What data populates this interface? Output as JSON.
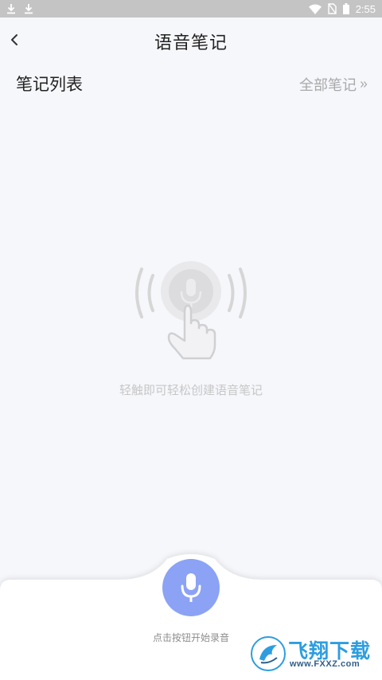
{
  "status_bar": {
    "time": "2:55",
    "icons": [
      "download-icon",
      "download-icon",
      "wifi-icon",
      "no-sim-icon",
      "battery-icon"
    ]
  },
  "header": {
    "title": "语音笔记",
    "back_icon": "chevron-left-icon"
  },
  "notes_list": {
    "title": "笔记列表",
    "all_notes_label": "全部笔记",
    "all_notes_icon": "chevron-double-right-icon"
  },
  "empty_state": {
    "illustration_icon": "touch-microphone-icon",
    "hint": "轻触即可轻松创建语音笔记"
  },
  "recorder": {
    "button_icon": "microphone-icon",
    "hint": "点击按钮开始录音"
  },
  "watermark": {
    "name": "飞翔下载",
    "url": "www.FXXZ.com"
  },
  "colors": {
    "background": "#f6f7fb",
    "accent": "#8ba2f5",
    "status_bar": "#c4c4c4",
    "watermark": "#2d9de0"
  }
}
